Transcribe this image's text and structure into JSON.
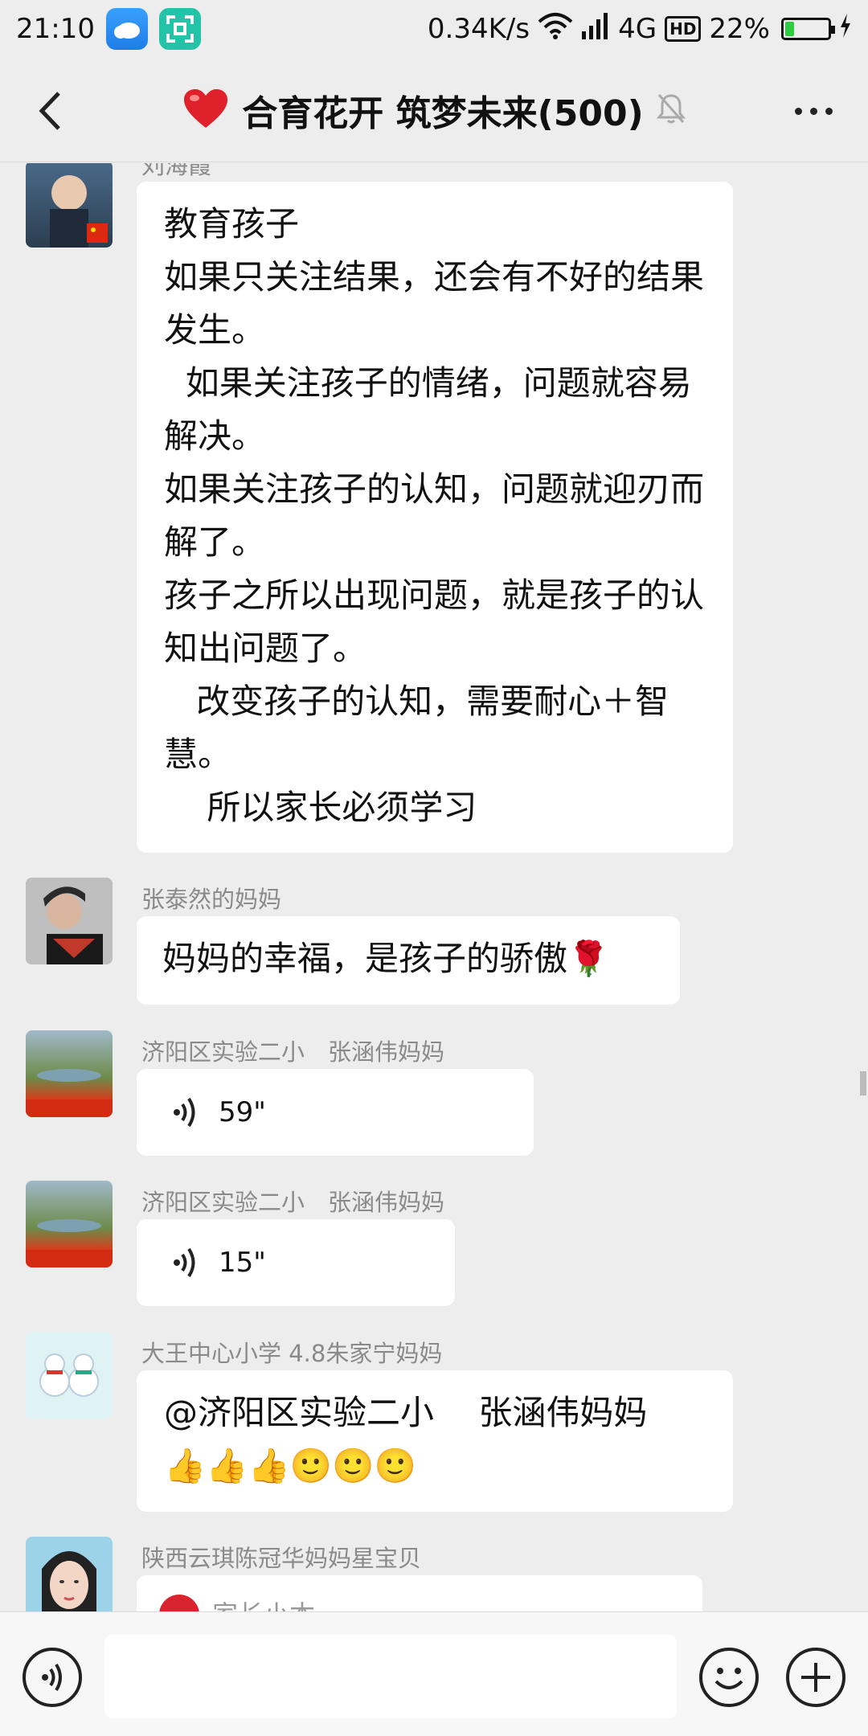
{
  "status": {
    "time": "21:10",
    "speed": "0.34K/s",
    "network": "4G",
    "hd": "HD",
    "battery": "22%",
    "battery_level": 0.22,
    "icons": [
      "weather-icon",
      "scan-icon",
      "wifi-icon",
      "signal-icon",
      "hd-icon",
      "battery-icon",
      "charging-icon"
    ]
  },
  "header": {
    "title": "合育花开 筑梦未来(500)",
    "icons": [
      "back-icon",
      "heart-icon",
      "mute-bell-icon",
      "more-icon"
    ]
  },
  "messages": [
    {
      "sender": "刘海霞",
      "type": "text",
      "text": "教育孩子\n如果只关注结果，还会有不好的结果发生。\n  如果关注孩子的情绪，问题就容易解决。\n如果关注孩子的认知，问题就迎刃而解了。\n孩子之所以出现问题，就是孩子的认知出问题了。\n   改变孩子的认知，需要耐心＋智慧。\n    所以家长必须学习"
    },
    {
      "sender": "张泰然的妈妈",
      "type": "text",
      "text": "妈妈的幸福，是孩子的骄傲🌹"
    },
    {
      "sender": "济阳区实验二小　张涵伟妈妈",
      "type": "voice",
      "duration": "59\""
    },
    {
      "sender": "济阳区实验二小　张涵伟妈妈",
      "type": "voice",
      "duration": "15\""
    },
    {
      "sender": "大王中心小学 4.8朱家宁妈妈",
      "type": "text",
      "text": "@济阳区实验二小　 张涵伟妈妈\n👍👍👍🙂🙂🙂"
    },
    {
      "sender": "陕西云琪陈冠华妈妈星宝贝",
      "type": "card",
      "text": "家长小本"
    }
  ],
  "input": {
    "placeholder": "",
    "icons": [
      "voice-input-icon",
      "emoji-icon",
      "plus-icon"
    ]
  }
}
